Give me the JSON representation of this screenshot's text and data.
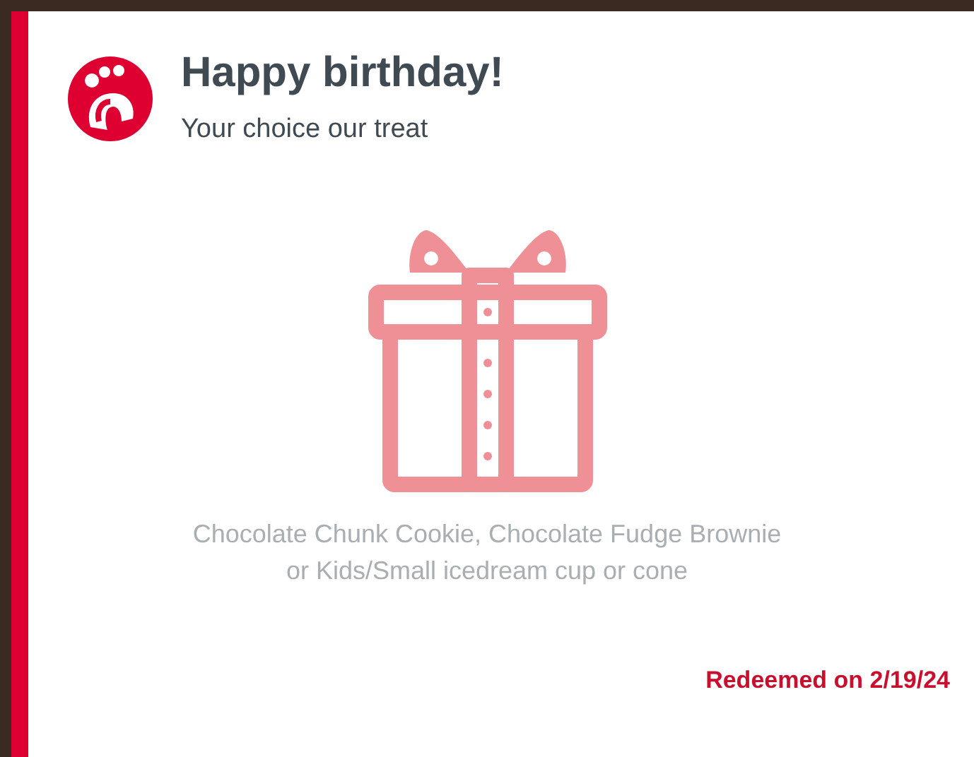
{
  "card": {
    "title": "Happy birthday!",
    "subtitle": "Your choice our treat",
    "description": [
      "Chocolate Chunk Cookie, Chocolate Fudge Brownie",
      "or Kids/Small icedream cup or cone"
    ],
    "status": "Redeemed on 2/19/24"
  }
}
